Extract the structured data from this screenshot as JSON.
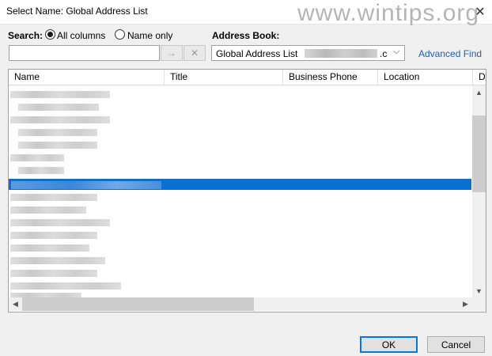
{
  "window": {
    "title": "Select Name: Global Address List",
    "watermark": "www.wintips.org",
    "close_glyph": "✕"
  },
  "search": {
    "label": "Search:",
    "options": [
      {
        "label": "All columns",
        "selected": true
      },
      {
        "label": "Name only",
        "selected": false
      }
    ],
    "input_value": "",
    "go_glyph": "→",
    "clear_glyph": "✕"
  },
  "address_book": {
    "label": "Address Book:",
    "value": "Global Address List",
    "suffix": ".c",
    "chevron": "⌵"
  },
  "advanced_find": "Advanced Find",
  "table": {
    "columns": [
      "Name",
      "Title",
      "Business Phone",
      "Location",
      "D"
    ]
  },
  "scroll": {
    "up": "▲",
    "down": "▼",
    "left": "◀",
    "right": "▶"
  },
  "buttons": {
    "ok": "OK",
    "cancel": "Cancel"
  },
  "colors": {
    "selection": "#0a6fd0",
    "link": "#1f5fa8",
    "accent": "#0078d7"
  }
}
